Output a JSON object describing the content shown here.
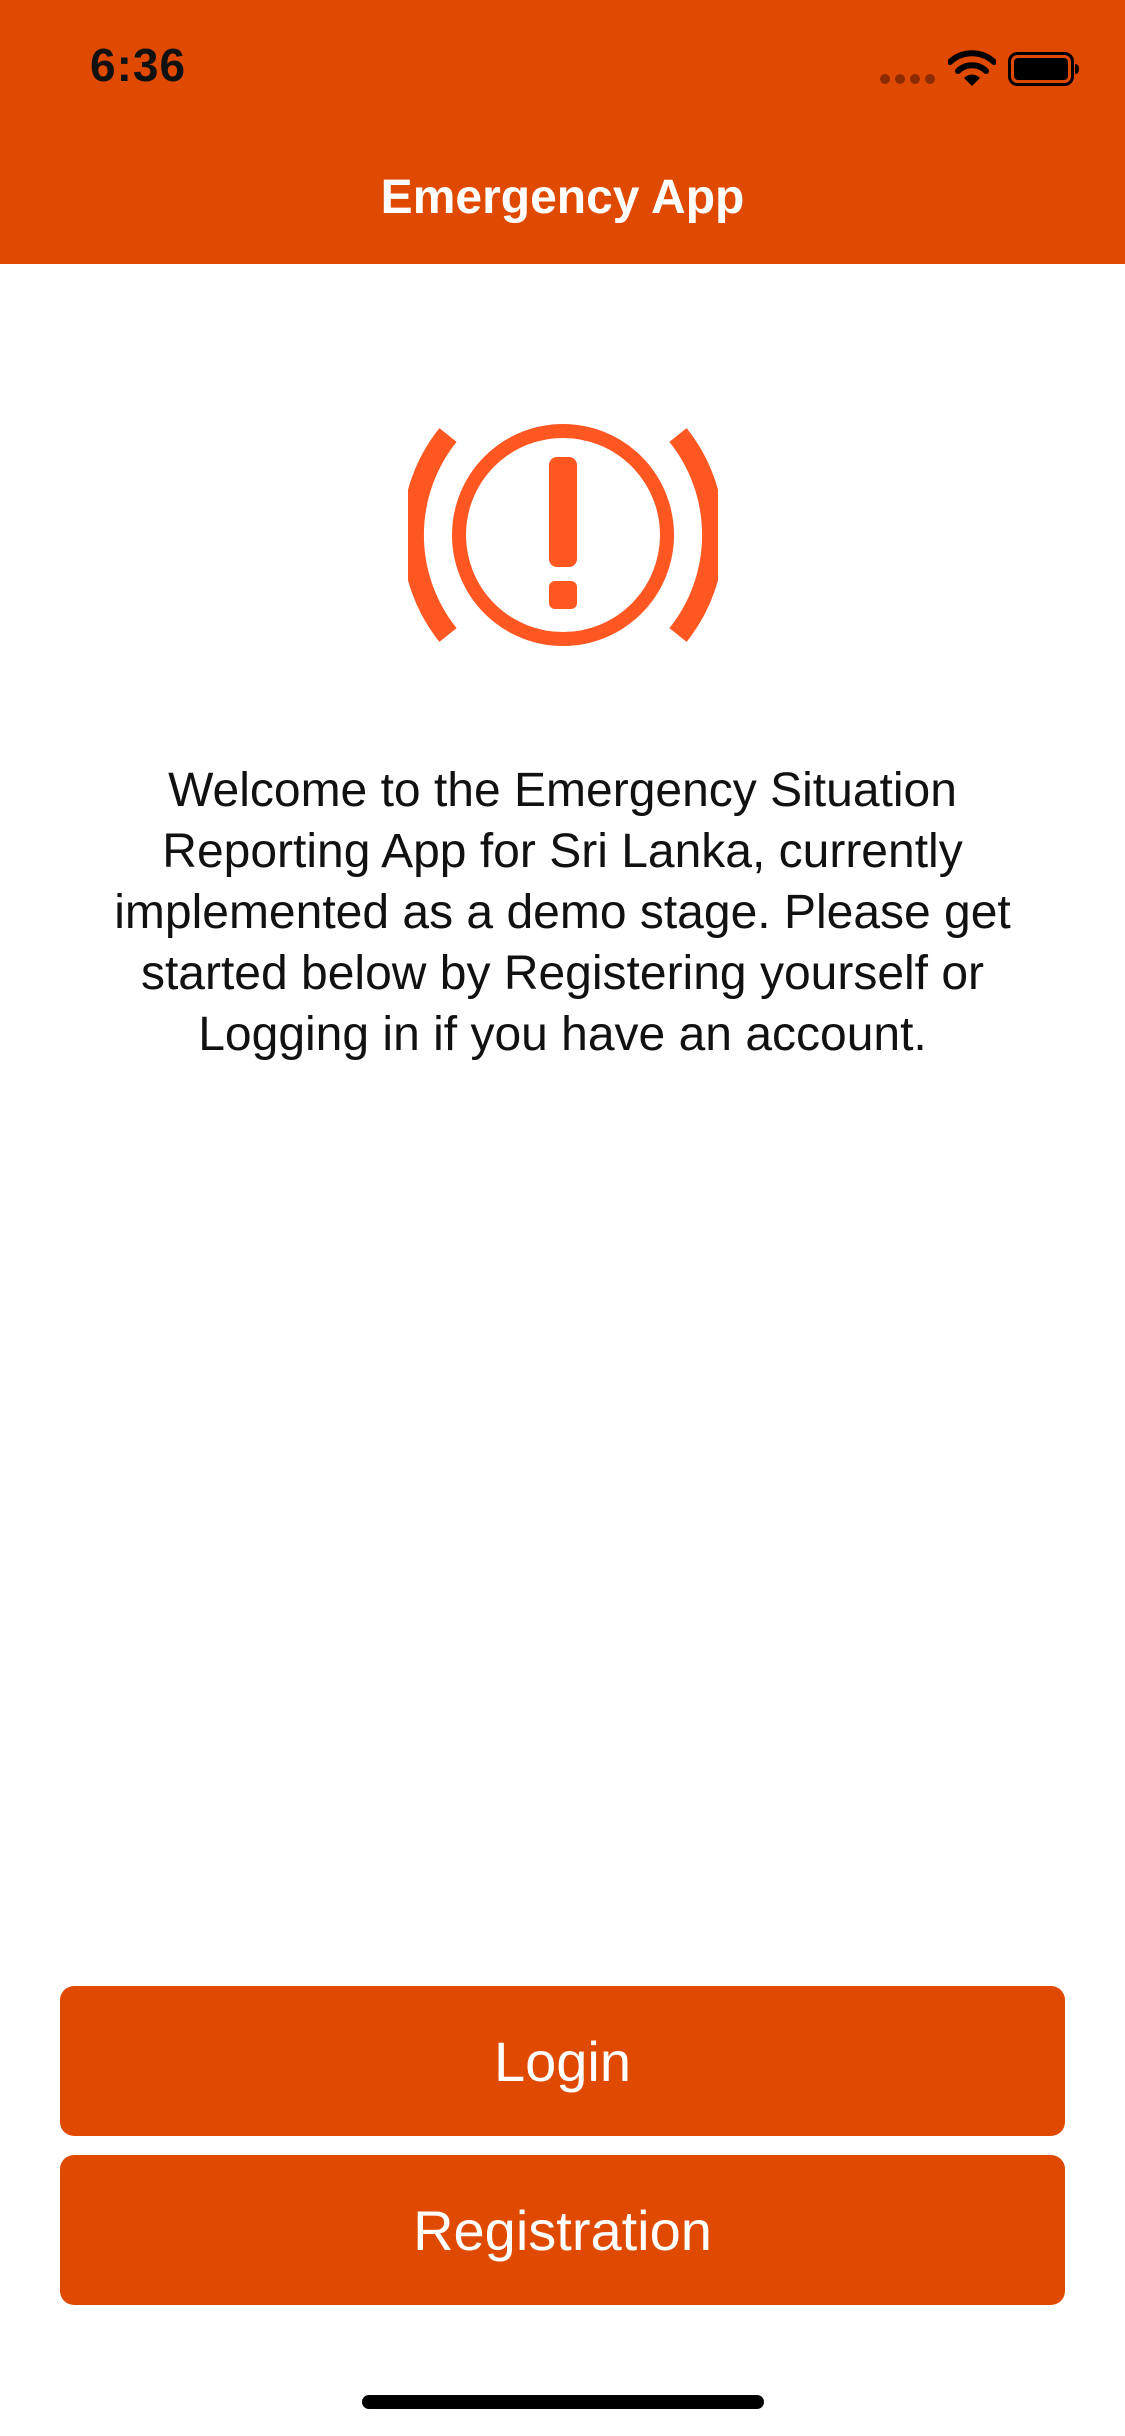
{
  "status_bar": {
    "time": "6:36",
    "icons": [
      "signal-dots-icon",
      "wifi-icon",
      "battery-icon"
    ]
  },
  "nav": {
    "title": "Emergency App"
  },
  "hero": {
    "icon": "alert-icon",
    "welcome_text": "Welcome to the Emergency Situation Reporting App for Sri Lanka, currently implemented as a demo stage. Please get started below by Registering yourself or Logging in if you have an account."
  },
  "actions": {
    "login_label": "Login",
    "registration_label": "Registration"
  },
  "colors": {
    "accent": "#E04A00",
    "icon_accent": "#FF5722",
    "background": "#FFFFFF",
    "text": "#111111"
  }
}
